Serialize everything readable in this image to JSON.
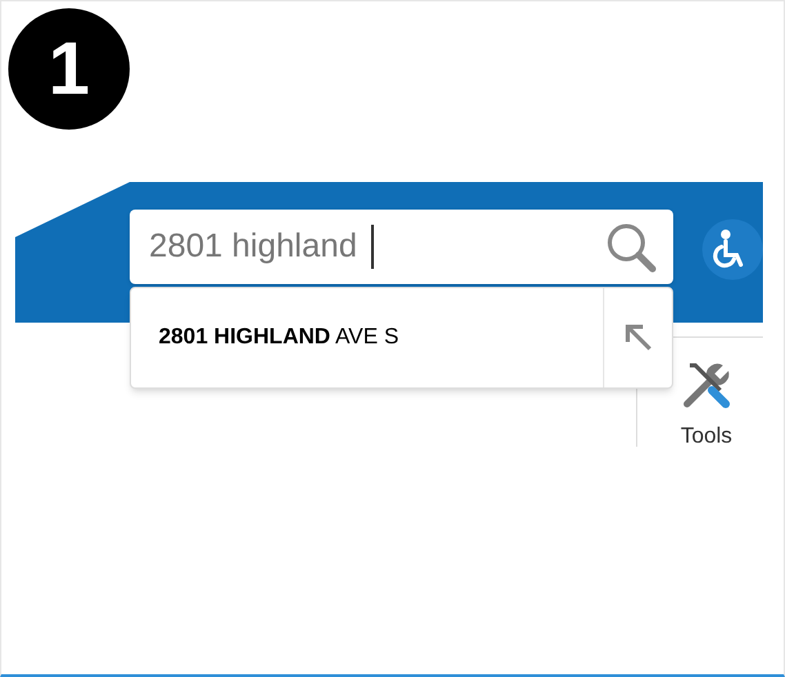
{
  "step_badge": "1",
  "search": {
    "value": "2801 highland"
  },
  "suggestions": [
    {
      "text": "**2801 HIGHLAND** AVE S"
    }
  ],
  "toolbar": [
    {
      "label": "Tools"
    }
  ]
}
